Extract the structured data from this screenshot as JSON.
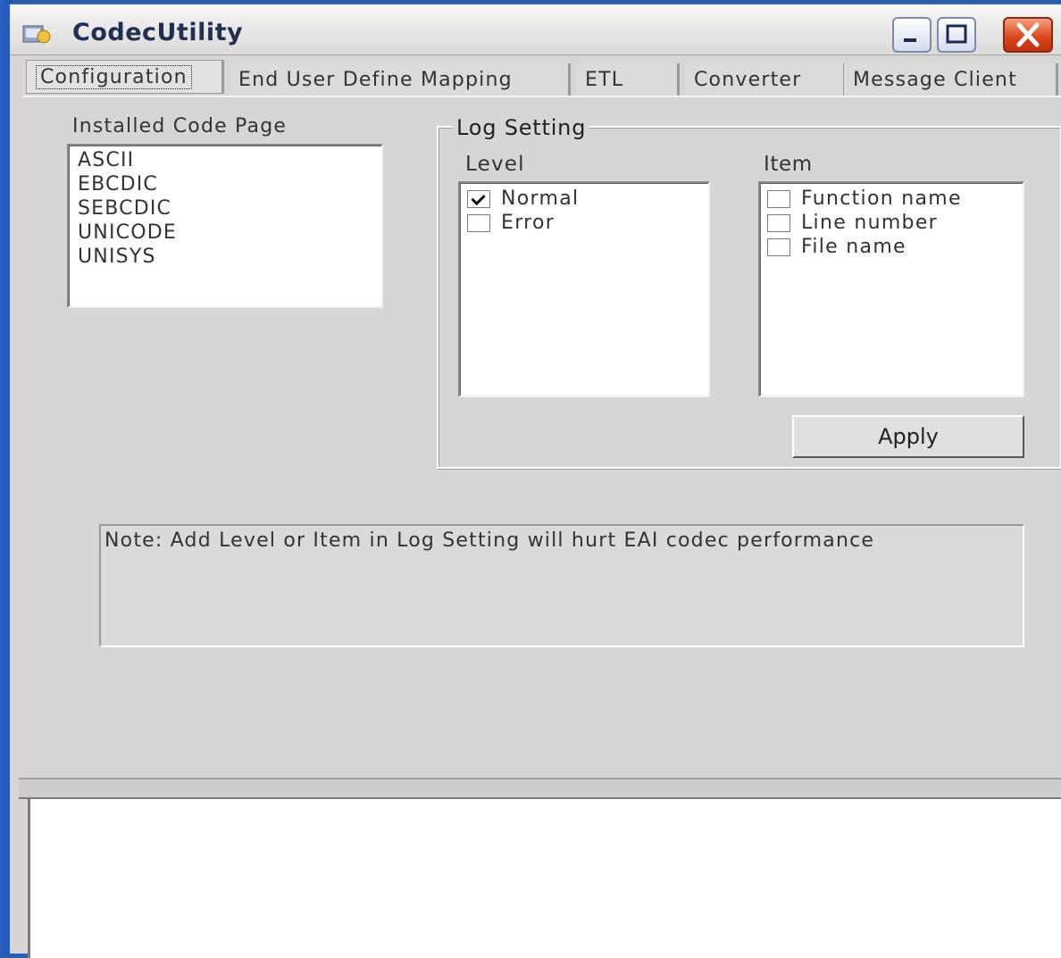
{
  "window": {
    "title": "CodecUtility"
  },
  "tabs": [
    {
      "label": "Configuration",
      "active": true
    },
    {
      "label": "End User Define Mapping",
      "active": false
    },
    {
      "label": "ETL",
      "active": false
    },
    {
      "label": "Converter",
      "active": false
    },
    {
      "label": "Message Client",
      "active": false
    }
  ],
  "code_page": {
    "label": "Installed Code Page",
    "items": [
      "ASCII",
      "EBCDIC",
      "SEBCDIC",
      "UNICODE",
      "UNISYS"
    ]
  },
  "log_setting": {
    "title": "Log Setting",
    "level_label": "Level",
    "item_label": "Item",
    "levels": [
      {
        "label": "Normal",
        "checked": true
      },
      {
        "label": "Error",
        "checked": false
      }
    ],
    "items": [
      {
        "label": "Function name",
        "checked": false
      },
      {
        "label": "Line number",
        "checked": false
      },
      {
        "label": "File name",
        "checked": false
      }
    ],
    "apply_label": "Apply"
  },
  "note": {
    "text": "Note: Add Level or Item in Log Setting will hurt EAI codec performance"
  }
}
